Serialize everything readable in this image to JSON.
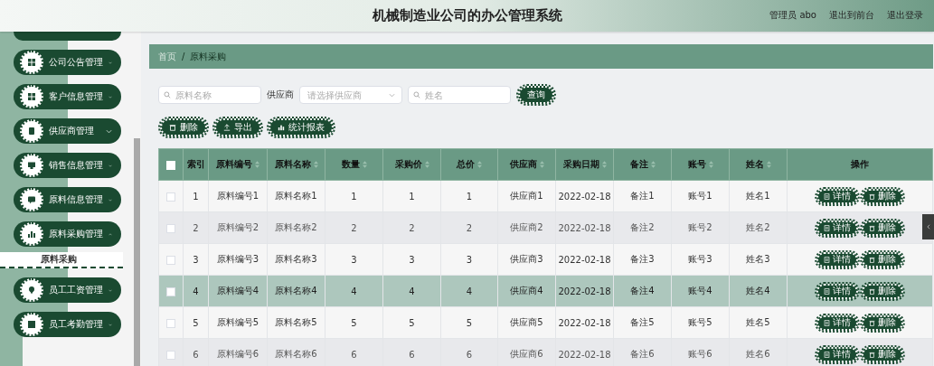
{
  "header": {
    "title": "机械制造业公司的办公管理系统",
    "links": [
      "管理员 abo",
      "退出到前台",
      "退出登录"
    ]
  },
  "sidebar": {
    "items": [
      {
        "label": "公司公告管理",
        "expanded": false
      },
      {
        "label": "客户信息管理",
        "expanded": false
      },
      {
        "label": "供应商管理",
        "expanded": false
      },
      {
        "label": "销售信息管理",
        "expanded": false
      },
      {
        "label": "原料信息管理",
        "expanded": false
      },
      {
        "label": "原料采购管理",
        "expanded": true,
        "children": [
          {
            "label": "原料采购",
            "selected": true
          }
        ]
      },
      {
        "label": "员工工资管理",
        "expanded": false
      },
      {
        "label": "员工考勤管理",
        "expanded": false
      }
    ]
  },
  "breadcrumb": [
    "首页",
    "/",
    "原料采购"
  ],
  "filters": {
    "name": {
      "placeholder": "原料名称"
    },
    "supplier_label": "供应商",
    "supplier": {
      "placeholder": "请选择供应商"
    },
    "person": {
      "placeholder": "姓名"
    },
    "search_button": "查询"
  },
  "toolbar": [
    "删除",
    "导出",
    "统计报表"
  ],
  "table": {
    "all_checked": false,
    "columns": [
      {
        "label": "索引",
        "sortable": false
      },
      {
        "label": "原料编号",
        "sortable": true
      },
      {
        "label": "原料名称",
        "sortable": true
      },
      {
        "label": "数量",
        "sortable": true
      },
      {
        "label": "采购价",
        "sortable": true
      },
      {
        "label": "总价",
        "sortable": true
      },
      {
        "label": "供应商",
        "sortable": true
      },
      {
        "label": "采购日期",
        "sortable": true
      },
      {
        "label": "备注",
        "sortable": true
      },
      {
        "label": "账号",
        "sortable": true
      },
      {
        "label": "姓名",
        "sortable": true
      },
      {
        "label": "操作",
        "sortable": false
      }
    ],
    "rows": [
      {
        "selected": false,
        "checked": false,
        "cells": [
          "1",
          "原料编号1",
          "原料名称1",
          "1",
          "1",
          "1",
          "供应商1",
          "2022-02-18",
          "备注1",
          "账号1",
          "姓名1"
        ],
        "actions": [
          "详情",
          "删除"
        ]
      },
      {
        "selected": false,
        "checked": false,
        "cells": [
          "2",
          "原料编号2",
          "原料名称2",
          "2",
          "2",
          "2",
          "供应商2",
          "2022-02-18",
          "备注2",
          "账号2",
          "姓名2"
        ],
        "actions": [
          "详情",
          "删除"
        ]
      },
      {
        "selected": false,
        "checked": false,
        "cells": [
          "3",
          "原料编号3",
          "原料名称3",
          "3",
          "3",
          "3",
          "供应商3",
          "2022-02-18",
          "备注3",
          "账号3",
          "姓名3"
        ],
        "actions": [
          "详情",
          "删除"
        ]
      },
      {
        "selected": true,
        "checked": false,
        "cells": [
          "4",
          "原料编号4",
          "原料名称4",
          "4",
          "4",
          "4",
          "供应商4",
          "2022-02-18",
          "备注4",
          "账号4",
          "姓名4"
        ],
        "actions": [
          "详情",
          "删除"
        ]
      },
      {
        "selected": false,
        "checked": false,
        "cells": [
          "5",
          "原料编号5",
          "原料名称5",
          "5",
          "5",
          "5",
          "供应商5",
          "2022-02-18",
          "备注5",
          "账号5",
          "姓名5"
        ],
        "actions": [
          "详情",
          "删除"
        ]
      },
      {
        "selected": false,
        "checked": false,
        "cells": [
          "6",
          "原料编号6",
          "原料名称6",
          "6",
          "6",
          "6",
          "供应商6",
          "2022-02-18",
          "备注6",
          "账号6",
          "姓名6"
        ],
        "actions": [
          "详情",
          "删除"
        ]
      }
    ]
  }
}
